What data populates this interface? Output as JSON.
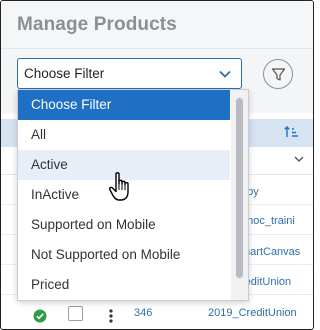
{
  "page": {
    "title": "Manage Products"
  },
  "filter": {
    "selected": "Choose Filter",
    "options": [
      "Choose Filter",
      "All",
      "Active",
      "InActive",
      "Supported on Mobile",
      "Not Supported on Mobile",
      "Priced"
    ],
    "highlighted_option": "Active"
  },
  "table": {
    "partial_links": [
      "opy",
      "dhoc_traini",
      "martCanvas",
      "reditUnion"
    ],
    "last_row": {
      "id": "346",
      "name": "2019_CreditUnion"
    }
  },
  "icons": {
    "select_toggle": "chevron-down-icon",
    "filter_button": "filter-icon",
    "sort": "sort-ascending-icon",
    "status": "check-circle-icon",
    "row_menu": "kebab-icon",
    "pointer": "hand-cursor-icon"
  },
  "colors": {
    "accent": "#1f6fc5",
    "link": "#2f6fa8",
    "status_ok": "#2e9e44",
    "header_bg": "#d6e4f2"
  }
}
